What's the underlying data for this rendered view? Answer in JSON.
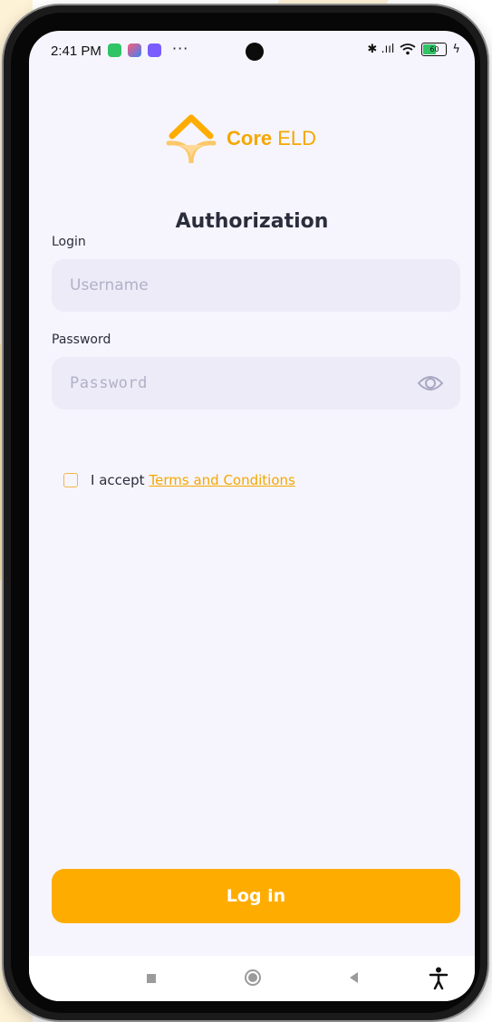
{
  "status_bar": {
    "time": "2:41 PM",
    "dots": "···",
    "signal": "✱ .ııl",
    "battery": "60"
  },
  "brand": {
    "name_bold": "Core",
    "name_light": "ELD",
    "accent_color": "#ffac00"
  },
  "page_title": "Authorization",
  "login": {
    "label": "Login",
    "placeholder": "Username",
    "value": ""
  },
  "password": {
    "label": "Password",
    "placeholder": "Password",
    "value": "",
    "toggle_icon": "eye-icon"
  },
  "terms": {
    "checked": false,
    "prefix": "I accept",
    "link_text": "Terms and Conditions"
  },
  "login_button_label": "Log in",
  "navigation": {
    "icons": [
      "recents-square-icon",
      "home-circle-icon",
      "back-triangle-icon",
      "accessibility-icon"
    ]
  }
}
